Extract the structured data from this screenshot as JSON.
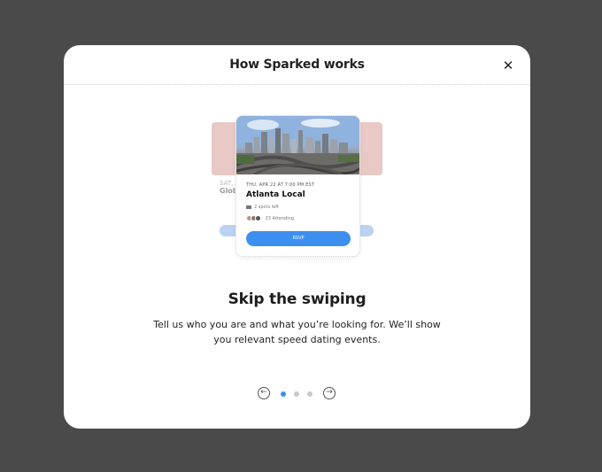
{
  "modal": {
    "title": "How Sparked works",
    "close_icon": "close-icon"
  },
  "illustration": {
    "event_card": {
      "date": "THU, APR 22 AT 7:00 PM EST",
      "name": "Atlanta Local",
      "spots": "2 spots left",
      "attending": "23 Attending",
      "button_label": "RSVP"
    },
    "ghost_card": {
      "date": "SAT, AP",
      "title": "Glob"
    }
  },
  "slide": {
    "headline": "Skip the swiping",
    "description": "Tell us who you are and what you’re looking for. We’ll show you relevant speed dating events."
  },
  "pager": {
    "prev_icon": "arrow-left-icon",
    "next_icon": "arrow-right-icon",
    "total_pages": 3,
    "active_page": 1
  },
  "colors": {
    "accent": "#3d8fef",
    "backdrop": "#4a4a4a",
    "card_accent": "#e8c9c6"
  }
}
